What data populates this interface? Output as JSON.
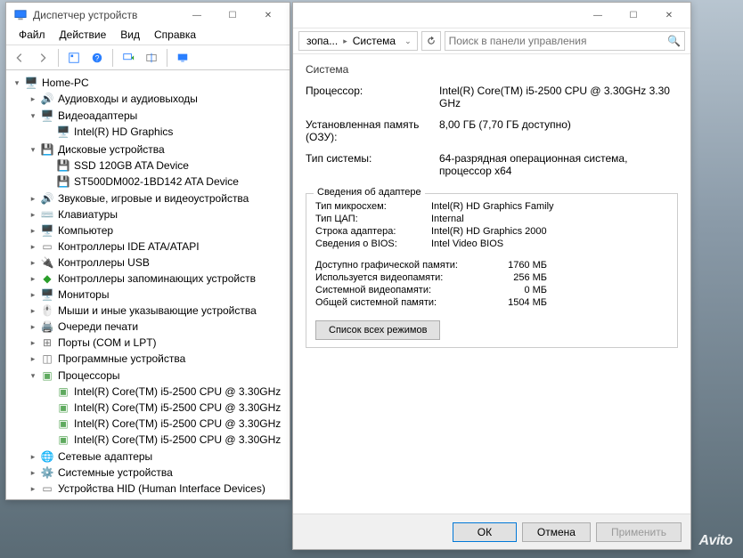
{
  "devmgr": {
    "title": "Диспетчер устройств",
    "menu": {
      "file": "Файл",
      "action": "Действие",
      "view": "Вид",
      "help": "Справка"
    },
    "root": "Home-PC",
    "nodes": {
      "audio": "Аудиовходы и аудиовыходы",
      "video": "Видеоадаптеры",
      "video_child": "Intel(R) HD Graphics",
      "disks": "Дисковые устройства",
      "disk1": "SSD 120GB ATA Device",
      "disk2": "ST500DM002-1BD142 ATA Device",
      "sound": "Звуковые, игровые и видеоустройства",
      "keyboard": "Клавиатуры",
      "computer": "Компьютер",
      "ide": "Контроллеры IDE ATA/ATAPI",
      "usb": "Контроллеры USB",
      "storage": "Контроллеры запоминающих устройств",
      "monitors": "Мониторы",
      "mice": "Мыши и иные указывающие устройства",
      "printq": "Очереди печати",
      "ports": "Порты (COM и LPT)",
      "software": "Программные устройства",
      "cpus": "Процессоры",
      "cpu_core": "Intel(R) Core(TM) i5-2500 CPU @ 3.30GHz",
      "netadp": "Сетевые адаптеры",
      "sysdev": "Системные устройства",
      "hid": "Устройства HID (Human Interface Devices)"
    }
  },
  "sys": {
    "breadcrumb": {
      "a": "зопа...",
      "b": "Система"
    },
    "search_ph": "Поиск в панели управления",
    "section": "Система",
    "props": {
      "cpu_label": "Процессор:",
      "cpu_value": "Intel(R) Core(TM) i5-2500 CPU @ 3.30GHz   3.30 GHz",
      "ram_label": "Установленная память (ОЗУ):",
      "ram_value": "8,00 ГБ (7,70 ГБ доступно)",
      "type_label": "Тип системы:",
      "type_value": "64-разрядная операционная система, процессор x64"
    },
    "adapter": {
      "title": "Сведения об адаптере",
      "rows": {
        "chip_l": "Тип микросхем:",
        "chip_v": "Intel(R) HD Graphics Family",
        "dac_l": "Тип ЦАП:",
        "dac_v": "Internal",
        "str_l": "Строка адаптера:",
        "str_v": "Intel(R) HD Graphics 2000",
        "bios_l": "Сведения о BIOS:",
        "bios_v": "Intel Video BIOS"
      },
      "mem": {
        "avail_l": "Доступно графической памяти:",
        "avail_v": "1760 МБ",
        "used_l": "Используется видеопамяти:",
        "used_v": "256 МБ",
        "sys_l": "Системной видеопамяти:",
        "sys_v": "0 МБ",
        "shared_l": "Общей системной памяти:",
        "shared_v": "1504 МБ"
      },
      "modes_btn": "Список всех режимов"
    },
    "buttons": {
      "ok": "ОК",
      "cancel": "Отмена",
      "apply": "Применить"
    }
  },
  "watermark": "Avito"
}
